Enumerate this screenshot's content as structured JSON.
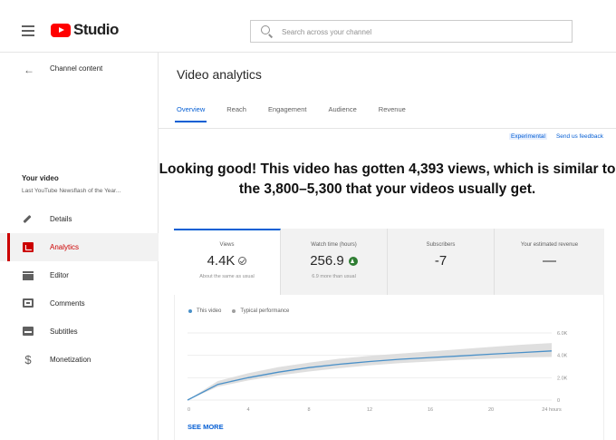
{
  "app": {
    "name": "Studio"
  },
  "search": {
    "placeholder": "Search across your channel"
  },
  "sidebar": {
    "back_label": "Channel content",
    "section_title": "Your video",
    "video_title": "Last YouTube Newsflash of the Year...",
    "items": [
      {
        "label": "Details",
        "icon": "pencil-icon"
      },
      {
        "label": "Analytics",
        "icon": "analytics-icon",
        "active": true
      },
      {
        "label": "Editor",
        "icon": "editor-icon"
      },
      {
        "label": "Comments",
        "icon": "comments-icon"
      },
      {
        "label": "Subtitles",
        "icon": "subtitles-icon"
      },
      {
        "label": "Monetization",
        "icon": "dollar-icon"
      }
    ]
  },
  "main": {
    "title": "Video analytics",
    "tabs": [
      "Overview",
      "Reach",
      "Engagement",
      "Audience",
      "Revenue"
    ],
    "active_tab": "Overview",
    "experimental_label": "Experimental",
    "feedback_label": "Send us feedback",
    "headline": "Looking good! This video has gotten 4,393 views, which is similar to the 3,800–5,300 that your videos usually get.",
    "stats": [
      {
        "label": "Views",
        "value": "4.4K",
        "sub": "About the same as usual",
        "icon": "check-circle-icon"
      },
      {
        "label": "Watch time (hours)",
        "value": "256.9",
        "sub": "6.9 more than usual",
        "icon": "arrow-up-circle-icon"
      },
      {
        "label": "Subscribers",
        "value": "-7",
        "sub": ""
      },
      {
        "label": "Your estimated revenue",
        "value": "—",
        "sub": ""
      }
    ],
    "see_more": "SEE MORE"
  },
  "colors": {
    "accent": "#065fd4",
    "brand": "#ff0000",
    "active_nav": "#cc0000",
    "line": "#4a90c8",
    "band": "#d9d9d9"
  },
  "chart_data": {
    "type": "line",
    "legend": [
      "This video",
      "Typical performance"
    ],
    "x": [
      0,
      2,
      4,
      6,
      8,
      10,
      12,
      14,
      16,
      18,
      20,
      22,
      24
    ],
    "x_ticks": [
      "0",
      "4",
      "8",
      "12",
      "16",
      "20",
      "24 hours"
    ],
    "x_tick_values": [
      0,
      4,
      8,
      12,
      16,
      20,
      24
    ],
    "y_ticks": [
      "0",
      "2.0K",
      "4.0K",
      "6.0K"
    ],
    "y_tick_values": [
      0,
      2000,
      4000,
      6000
    ],
    "ylim": [
      0,
      6000
    ],
    "series": [
      {
        "name": "This video",
        "values": [
          0,
          1400,
          2000,
          2500,
          2900,
          3200,
          3450,
          3650,
          3800,
          3950,
          4100,
          4250,
          4393
        ]
      },
      {
        "name": "Typical performance",
        "low": [
          0,
          1200,
          1750,
          2200,
          2550,
          2850,
          3100,
          3300,
          3450,
          3600,
          3700,
          3800,
          3850
        ],
        "high": [
          0,
          1700,
          2400,
          2950,
          3350,
          3700,
          3950,
          4150,
          4350,
          4550,
          4750,
          4950,
          5100
        ]
      }
    ]
  }
}
